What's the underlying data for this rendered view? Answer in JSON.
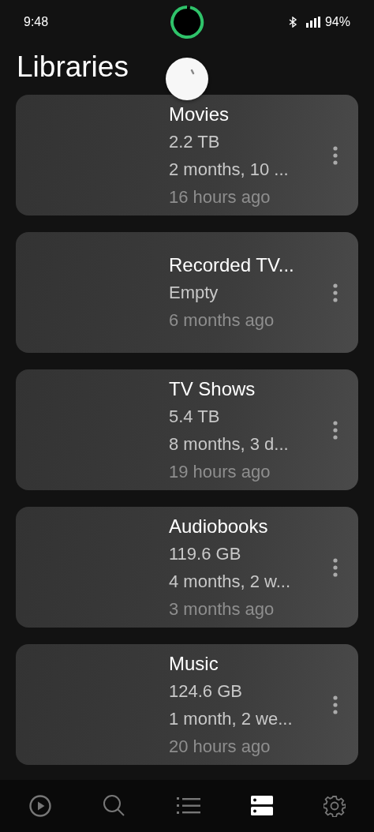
{
  "status_bar": {
    "time": "9:48",
    "battery": "94%"
  },
  "title": "Libraries",
  "libraries": [
    {
      "name": "Movies",
      "size": "2.2 TB",
      "duration": "2 months, 10 ...",
      "updated": "16 hours ago"
    },
    {
      "name": "Recorded TV...",
      "size": "Empty",
      "updated": "6 months ago"
    },
    {
      "name": "TV Shows",
      "size": "5.4 TB",
      "duration": "8 months, 3 d...",
      "updated": "19 hours ago"
    },
    {
      "name": "Audiobooks",
      "size": "119.6 GB",
      "duration": "4 months, 2 w...",
      "updated": "3 months ago"
    },
    {
      "name": "Music",
      "size": "124.6 GB",
      "duration": "1 month, 2 we...",
      "updated": "20 hours ago"
    }
  ],
  "nav": [
    {
      "kind": "play",
      "selected": false
    },
    {
      "kind": "search",
      "selected": false
    },
    {
      "kind": "list",
      "selected": false
    },
    {
      "kind": "libraries",
      "selected": true
    },
    {
      "kind": "settings",
      "selected": false
    }
  ]
}
